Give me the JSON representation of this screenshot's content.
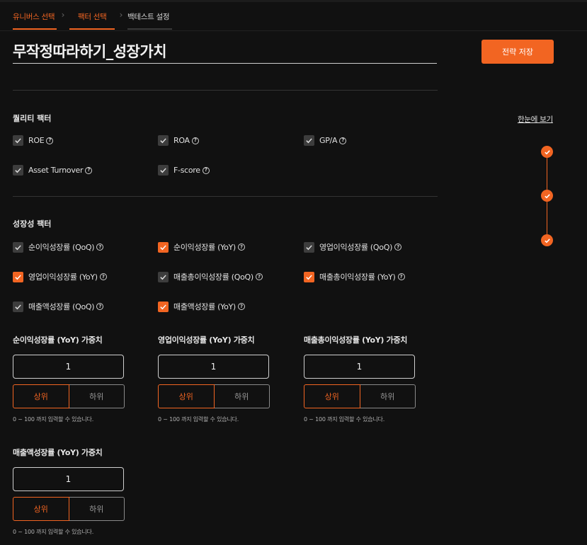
{
  "steps": [
    {
      "label": "유니버스 선택"
    },
    {
      "label": "팩터 선택"
    },
    {
      "label": "백테스트 설정"
    }
  ],
  "title": "무작정따라하기_성장가치",
  "save_label": "전략 저장",
  "overview_label": "한눈에 보기",
  "quality": {
    "title": "퀄리티 팩터",
    "items": [
      {
        "label": "ROE",
        "checked": true,
        "style": "grey"
      },
      {
        "label": "ROA",
        "checked": true,
        "style": "grey"
      },
      {
        "label": "GP/A",
        "checked": true,
        "style": "grey"
      },
      {
        "label": "Asset Turnover",
        "checked": true,
        "style": "grey"
      },
      {
        "label": "F-score",
        "checked": true,
        "style": "grey"
      }
    ]
  },
  "growth": {
    "title": "성장성 팩터",
    "items": [
      {
        "label": "순이익성장률 (QoQ)",
        "checked": true,
        "style": "grey"
      },
      {
        "label": "순이익성장률 (YoY)",
        "checked": true,
        "style": "orange"
      },
      {
        "label": "영업이익성장률 (QoQ)",
        "checked": true,
        "style": "grey"
      },
      {
        "label": "영업이익성장률 (YoY)",
        "checked": true,
        "style": "orange"
      },
      {
        "label": "매출총이익성장률 (QoQ)",
        "checked": true,
        "style": "grey"
      },
      {
        "label": "매출총이익성장률 (YoY)",
        "checked": true,
        "style": "orange"
      },
      {
        "label": "매출액성장률 (QoQ)",
        "checked": true,
        "style": "grey"
      },
      {
        "label": "매출액성장률 (YoY)",
        "checked": true,
        "style": "orange"
      }
    ]
  },
  "weights": [
    {
      "label": "순이익성장률 (YoY) 가중치",
      "value": "1",
      "upper": "상위",
      "lower": "하위",
      "hint": "0 ~ 100 까지 입력할 수 있습니다."
    },
    {
      "label": "영업이익성장률 (YoY) 가중치",
      "value": "1",
      "upper": "상위",
      "lower": "하위",
      "hint": "0 ~ 100 까지 입력할 수 있습니다."
    },
    {
      "label": "매출총이익성장률 (YoY) 가중치",
      "value": "1",
      "upper": "상위",
      "lower": "하위",
      "hint": "0 ~ 100 까지 입력할 수 있습니다."
    },
    {
      "label": "매출액성장률 (YoY) 가중치",
      "value": "1",
      "upper": "상위",
      "lower": "하위",
      "hint": "0 ~ 100 까지 입력할 수 있습니다."
    }
  ],
  "colors": {
    "accent": "#f26522",
    "background": "#111111",
    "checkbox_grey": "#3d3d3d"
  }
}
